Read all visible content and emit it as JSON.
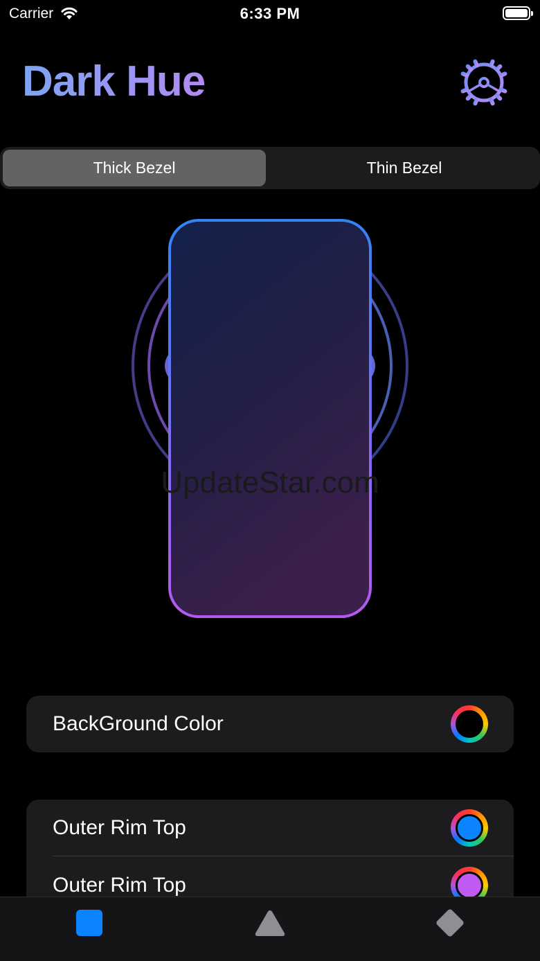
{
  "status_bar": {
    "carrier": "Carrier",
    "time": "6:33 PM"
  },
  "header": {
    "title": "Dark Hue",
    "settings_icon": "gear-icon"
  },
  "bezel_selector": {
    "options": [
      "Thick Bezel",
      "Thin Bezel"
    ],
    "selected": "Thick Bezel"
  },
  "watermark": "UpdateStar.com",
  "settings": {
    "background_color": {
      "label": "BackGround Color",
      "color": "#000000"
    },
    "rim_rows": [
      {
        "label": "Outer Rim Top",
        "color": "#0a84ff"
      },
      {
        "label": "Outer Rim Top",
        "color": "#bf5af2"
      }
    ]
  },
  "tab_bar": {
    "tabs": [
      {
        "icon": "square-icon",
        "color": "#0a84ff"
      },
      {
        "icon": "triangle-icon",
        "color": "#8e8e93"
      },
      {
        "icon": "diamond-icon",
        "color": "#8e8e93"
      }
    ]
  }
}
